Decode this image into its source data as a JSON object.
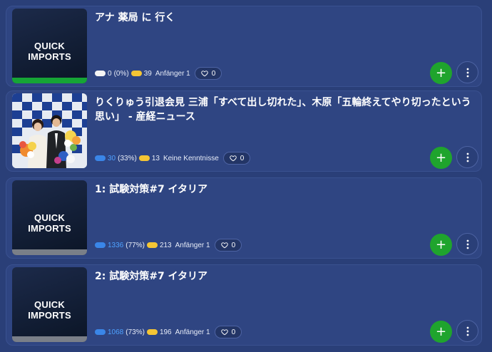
{
  "colors": {
    "page_bg": "#2a3f78",
    "card_bg": "#2f4582",
    "add_button": "#1fa42d",
    "known_pill": "#3a86e8",
    "learning_pill": "#f4c534",
    "green_bar": "#16a536",
    "grey_bar": "#7a7f88"
  },
  "lessons": [
    {
      "thumbnail_text": "QUICK IMPORTS",
      "title": "アナ 薬局 に 行く",
      "known_count": "0",
      "known_percent": "(0%)",
      "learning_count": "39",
      "level": "Anfänger 1",
      "likes": "0",
      "progress_fraction": 1.0
    },
    {
      "thumbnail_text": "",
      "title": "りくりゅう引退会見 三浦「すべて出し切れた」、木原「五輪終えてやり切ったという思い」 - 産経ニュース",
      "known_count": "30",
      "known_percent": "(33%)",
      "learning_count": "13",
      "level": "Keine Kenntnisse",
      "likes": "0",
      "progress_fraction": 0
    },
    {
      "thumbnail_text": "QUICK IMPORTS",
      "title": "1: 試験対策#7 イタリア",
      "known_count": "1336",
      "known_percent": "(77%)",
      "learning_count": "213",
      "level": "Anfänger 1",
      "likes": "0",
      "progress_fraction": 0
    },
    {
      "thumbnail_text": "QUICK IMPORTS",
      "title": "2: 試験対策#7 イタリア",
      "known_count": "1068",
      "known_percent": "(73%)",
      "learning_count": "196",
      "level": "Anfänger 1",
      "likes": "0",
      "progress_fraction": 0
    }
  ],
  "icons": {
    "add": "plus-icon",
    "more": "more-vertical-icon",
    "like": "heart-icon"
  },
  "buttons": {
    "add_symbol": "+"
  }
}
